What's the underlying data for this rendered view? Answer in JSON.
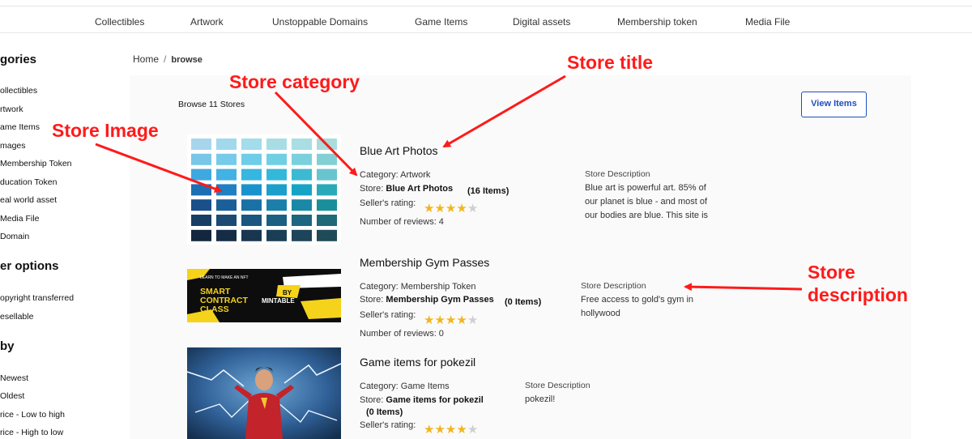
{
  "nav": {
    "items": [
      "Collectibles",
      "Artwork",
      "Unstoppable Domains",
      "Game Items",
      "Digital assets",
      "Membership token",
      "Media File"
    ]
  },
  "sidebar": {
    "categories_heading": "gories",
    "categories": [
      "ollectibles",
      "rtwork",
      "ame Items",
      "mages",
      "Membership Token",
      "ducation Token",
      "eal world asset",
      "Media File",
      "Domain"
    ],
    "other_heading": "er options",
    "other": [
      "opyright transferred",
      "esellable"
    ],
    "sort_heading": "by",
    "sort": [
      "Newest",
      "Oldest",
      "rice - Low to high",
      "rice - High to low"
    ]
  },
  "breadcrumb": {
    "home": "Home",
    "separator": "/",
    "current": "browse"
  },
  "browse": {
    "count_label": "Browse 11 Stores",
    "view_items_label": "View Items"
  },
  "stores": [
    {
      "title": "Blue Art Photos",
      "category_label": "Category:",
      "category": "Artwork",
      "store_label": "Store:",
      "store": "Blue Art Photos",
      "items": "(16 Items)",
      "rating_label": "Seller's rating:",
      "rating": 4,
      "reviews": "Number of reviews: 4",
      "desc_head": "Store Description",
      "desc_lines": [
        "Blue art is powerful art. 85% of",
        "our planet is blue - and most of",
        "our bodies are blue. This site is"
      ]
    },
    {
      "title": "Membership Gym Passes",
      "category_label": "Category:",
      "category": "Membership Token",
      "store_label": "Store:",
      "store": "Membership Gym Passes",
      "items": "(0 Items)",
      "rating_label": "Seller's rating:",
      "rating": 4,
      "reviews": "Number of reviews: 0",
      "desc_head": "Store Description",
      "desc_lines": [
        "Free access to gold's gym in",
        "hollywood"
      ],
      "thumb_text": {
        "small": "LEARN TO MAKE AN NFT",
        "line1": "SMART",
        "line2": "CONTRACT",
        "line3": "CLASS",
        "by": "BY",
        "brand": "MINTABLE"
      }
    },
    {
      "title": "Game items for pokezil",
      "category_label": "Category:",
      "category": "Game Items",
      "store_label": "Store:",
      "store": "Game items for pokezil",
      "items": "(0 Items)",
      "rating_label": "Seller's rating:",
      "rating": 4,
      "desc_head": "Store Description",
      "desc_lines": [
        "pokezil!"
      ]
    }
  ],
  "annotations": {
    "store_title": "Store title",
    "store_category": "Store category",
    "store_image": "Store Image",
    "store_description_1": "Store",
    "store_description_2": "description"
  },
  "colors": {
    "annotation": "#ff1a1a",
    "accent": "#1e4fbf",
    "star_on": "#f3b51b",
    "star_off": "#cfcfcf"
  },
  "swatches": [
    [
      "#a7d6ec",
      "#a1d8ec",
      "#a3dceb",
      "#a8dde6",
      "#a9dee2",
      "#a8dddb"
    ],
    [
      "#79c6e8",
      "#77cbea",
      "#6fcde8",
      "#6fd0e4",
      "#7ad1dd",
      "#82d0d4"
    ],
    [
      "#3fa8e0",
      "#42b1e3",
      "#36b6e0",
      "#33b8da",
      "#3db9d1",
      "#68c5cf"
    ],
    [
      "#1c6fb3",
      "#1f80c3",
      "#1a93cc",
      "#1aa0cb",
      "#17a4c4",
      "#2aaab9"
    ],
    [
      "#1a4f8a",
      "#1a5f98",
      "#1a71a6",
      "#1a7fa9",
      "#1a88a6",
      "#1a8e9b"
    ],
    [
      "#183e63",
      "#1b4a73",
      "#1a5680",
      "#1b6082",
      "#1c6680",
      "#1f6a79"
    ],
    [
      "#13263d",
      "#152c47",
      "#193651",
      "#1b3e57",
      "#1d4458",
      "#1f4a57"
    ]
  ]
}
